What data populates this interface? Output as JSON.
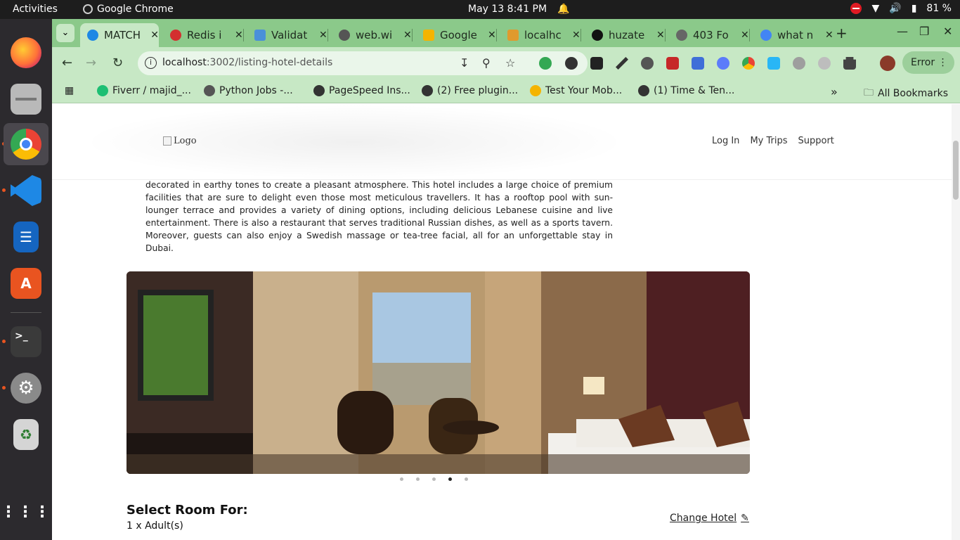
{
  "system_bar": {
    "activities": "Activities",
    "app_name": "Google Chrome",
    "datetime": "May 13  8:41 PM",
    "battery": "81 %"
  },
  "dock": {
    "apps": [
      "Firefox",
      "Files",
      "Google Chrome",
      "Visual Studio Code",
      "LibreOffice Writer",
      "Ubuntu Software",
      "Terminal",
      "Settings",
      "Trash",
      "Show Applications"
    ]
  },
  "browser": {
    "tabs": [
      {
        "label": "MATCH",
        "favicon_color": "#1e88e5"
      },
      {
        "label": "Redis i",
        "favicon_color": "#d32f2f"
      },
      {
        "label": "Validat",
        "favicon_color": "#4a90d9"
      },
      {
        "label": "web.wi",
        "favicon_color": "#555555"
      },
      {
        "label": "Google",
        "favicon_color": "#f4b400"
      },
      {
        "label": "localhc",
        "favicon_color": "#e09a2d"
      },
      {
        "label": "huzate",
        "favicon_color": "#111111"
      },
      {
        "label": "403 Fo",
        "favicon_color": "#666666"
      },
      {
        "label": "what n",
        "favicon_color": "#4285f4"
      }
    ],
    "url_host": "localhost",
    "url_path": ":3002/listing-hotel-details",
    "profile_status": "Error",
    "bookmarks": [
      {
        "label": "Fiverr / majid_...",
        "color": "#1dbf73"
      },
      {
        "label": "Python Jobs -...",
        "color": "#555555"
      },
      {
        "label": "PageSpeed Ins...",
        "color": "#333333"
      },
      {
        "label": "(2) Free plugin...",
        "color": "#333333"
      },
      {
        "label": "Test Your Mob...",
        "color": "#f4b400"
      },
      {
        "label": "(1) Time & Ten...",
        "color": "#333333"
      }
    ],
    "all_bookmarks": "All Bookmarks"
  },
  "site": {
    "logo_alt": "Logo",
    "nav": [
      "Log In",
      "My Trips",
      "Support"
    ],
    "description": "decorated in earthy tones to create a pleasant atmosphere. This hotel includes a large choice of premium facilities that are sure to delight even those most meticulous travellers. It has a rooftop pool with sun-lounger terrace and provides a variety of dining options, including delicious Lebanese cuisine and live entertainment. There is also a restaurant that serves traditional Russian dishes, as well as a sports tavern. Moreover, guests can also enjoy a Swedish massage or tea-tree facial, all for an unforgettable stay in Dubai.",
    "carousel": {
      "slide_count": 5,
      "active_slide": 4
    },
    "select_room_title": "Select Room For:",
    "guests": "1 x Adult(s)",
    "change_hotel": "Change Hotel"
  }
}
